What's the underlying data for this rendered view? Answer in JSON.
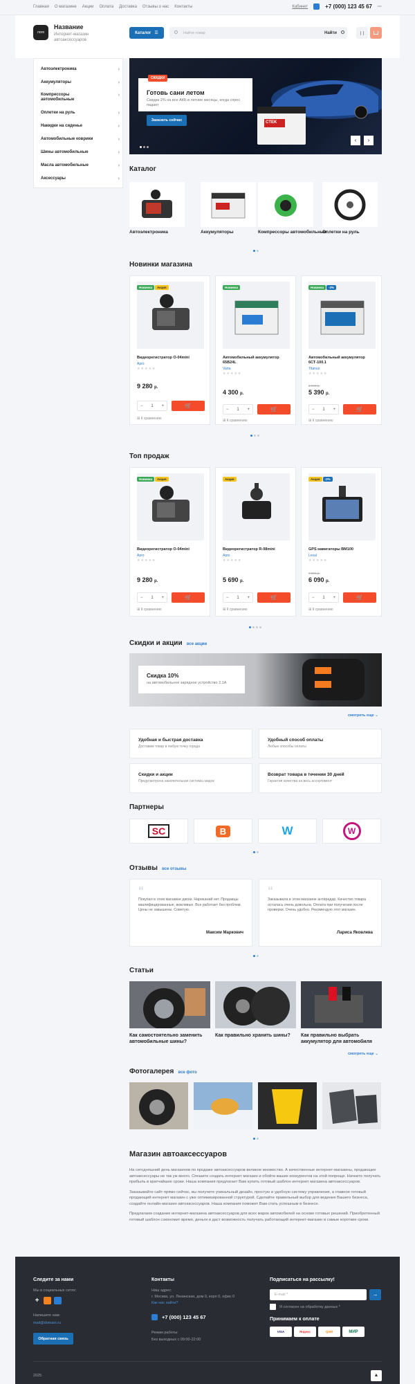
{
  "topnav": {
    "items": [
      "Главная",
      "О магазине",
      "Акции",
      "Оплата",
      "Доставка",
      "Отзывы о нас",
      "Контакты"
    ],
    "cabinet": "Кабинет",
    "phone": "+7 (000) 123 45 67",
    "more": "···"
  },
  "header": {
    "logo": "лого",
    "site_name": "Название",
    "site_sub": "Интернет-магазин автоаксессуаров",
    "catalog_btn": "Каталог",
    "search_placeholder": "Найти товар",
    "find": "Найти"
  },
  "sidebar": {
    "items": [
      "Автоэлектроника",
      "Аккумуляторы",
      "Компрессоры автомобильные",
      "Оплетки на руль",
      "Накидки на сиденье",
      "Автомобильные коврики",
      "Шины автомобильные",
      "Масла автомобильные",
      "Аксессуары"
    ]
  },
  "banner": {
    "tag": "СКИДКИ",
    "title": "Готовь сани летом",
    "text": "Скидка 2% на все АКБ в летние месяцы, когда спрос падает",
    "button": "Заказать сейчас",
    "battery_label": "CTEK"
  },
  "catalog": {
    "title": "Каталог",
    "items": [
      "Автоэлектроника",
      "Аккумуляторы",
      "Компрессоры автомобильные",
      "Оплетки на руль"
    ]
  },
  "new_products": {
    "title": "Новинки магазина",
    "items": [
      {
        "badges": [
          "Новинка",
          "Акция"
        ],
        "name": "Видеорегистратор O-04mini",
        "brand": "Apro",
        "old": "",
        "price": "9 280",
        "currency": "р.",
        "qty": "1",
        "compare": "К сравнению"
      },
      {
        "badges": [
          "Новинка"
        ],
        "name": "Автомобильный аккумулятор 65B24L",
        "brand": "Varta",
        "old": "",
        "price": "4 300",
        "currency": "р.",
        "qty": "1",
        "compare": "К сравнению"
      },
      {
        "badges": [
          "Новинка",
          "-3%"
        ],
        "name": "Автомобильный аккумулятор 6СТ-100.1",
        "brand": "Titanus",
        "old": "5 990 р.",
        "price": "5 390",
        "currency": "р.",
        "qty": "1",
        "compare": "К сравнению"
      }
    ]
  },
  "top_sales": {
    "title": "Топ продаж",
    "items": [
      {
        "badges": [
          "Новинка",
          "Акция"
        ],
        "name": "Видеорегистратор O-04mini",
        "brand": "Apro",
        "old": "",
        "price": "9 280",
        "currency": "р.",
        "qty": "1",
        "compare": "К сравнению"
      },
      {
        "badges": [
          "Акция"
        ],
        "name": "Видеорегистратор R-08mini",
        "brand": "Apro",
        "old": "",
        "price": "5 690",
        "currency": "р.",
        "qty": "1",
        "compare": "К сравнению"
      },
      {
        "badges": [
          "Акция",
          "-2%"
        ],
        "name": "GPS навигаторы BM100",
        "brand": "Lexal",
        "old": "7 000 р.",
        "price": "6 090",
        "currency": "р.",
        "qty": "1",
        "compare": "К сравнению"
      }
    ]
  },
  "promo": {
    "title": "Скидки и акции",
    "all": "все акции",
    "card_title": "Скидка 10%",
    "card_text": "на автомобильное зарядное устройство 2.1A",
    "more": "смотреть еще"
  },
  "features": [
    {
      "title": "Удобная и быстрая доставка",
      "text": "Доставим товар в любую точку города"
    },
    {
      "title": "Удобный способ оплаты",
      "text": "Любые способы оплаты"
    },
    {
      "title": "Скидки и акции",
      "text": "Предусмотрена накопительная система скидок"
    },
    {
      "title": "Возврат товара в течении 30 дней",
      "text": "Гарантия качества на весь ассортимент"
    }
  ],
  "partners": {
    "title": "Партнеры",
    "logos": [
      "SC",
      "B",
      "W",
      "W"
    ]
  },
  "reviews": {
    "title": "Отзывы",
    "all": "все отзывы",
    "items": [
      {
        "text": "Покупал в этом магазине диски. Нареканий нет. Продавцы квалифицированные, вежливые. Все работает без проблем. Цены не завышены. Советую.",
        "author": "Максим Маркович"
      },
      {
        "text": "Заказывала в этом магазине антирадар. Качество товара осталась очень довольна. Оплата при получении после проверки. Очень удобно. Рекомендую этот магазин.",
        "author": "Лариса Яковлева"
      }
    ]
  },
  "articles": {
    "title": "Статьи",
    "items": [
      "Как самостоятельно заменить автомобильные шины?",
      "Как правильно хранить шины?",
      "Как правильно выбрать аккумулятор для автомобиля"
    ],
    "more": "смотреть еще"
  },
  "gallery": {
    "title": "Фотогалерея",
    "all": "все фото"
  },
  "about": {
    "title": "Магазин автоаксессуаров",
    "paragraphs": [
      "На сегодняшний день магазинов по продаже автоаксессуаров великое множество. А качественные интернет-магазины, продающие автоаксессуары не так уж много. Спешите создать интернет магазин и обойти ваших конкурентов на этой попроще. Начните получать прибыль в кратчайшие сроки. Наша компания предлагает Вам купить готовый шаблон интернет магазина автоаксессуаров.",
      "Заказывайте сайт прямо сейчас, вы получите уникальный дизайн, простую и удобную систему управления, а главное готовый продающий интернет магазин с уже оптимизированной структурой. Сделайте правильный выбор для ведения Вашего бизнеса, создайте онлайн-магазин автоаксессуаров. Наша компания поможет Вам стать успешным в бизнесе.",
      "Предлагаем создание интернет-магазина автоаксессуаров для всех марок автомобилей на основе готовых решений. Приобретенный готовый шаблон сэкономит время, деньги и даст возможность получать работающий интернет-магазин в самые короткие сроки."
    ]
  },
  "footer": {
    "follow_title": "Следите за нами",
    "follow_sub": "Мы в социальных сетях:",
    "write_title": "Напишите нам:",
    "email": "mail@domain.ru",
    "feedback_btn": "Обратная связь",
    "contacts_title": "Контакты",
    "address_label": "Наш адрес:",
    "address": "г. Москва, ул. Ленинская, дом 0, корп 0, офис 0",
    "map": "Как нас найти?",
    "phone": "+7 (000) 123 45 67",
    "hours_label": "Режим работы:",
    "hours": "Без выходных с 09:00-22:00",
    "subscribe_title": "Подписаться на рассылку!",
    "email_placeholder": "E-mail *",
    "agree": "Я согласен на обработку данных *",
    "pay_title": "Принимаем к оплате",
    "pay": [
      "VISA",
      "Яндекс",
      "QIWI",
      "МИР"
    ],
    "year": "2025"
  },
  "colors": {
    "accent": "#1b6fb4",
    "cta": "#f44b2a",
    "new": "#3aa957",
    "sale": "#f5c41f",
    "footer": "#292c33"
  }
}
